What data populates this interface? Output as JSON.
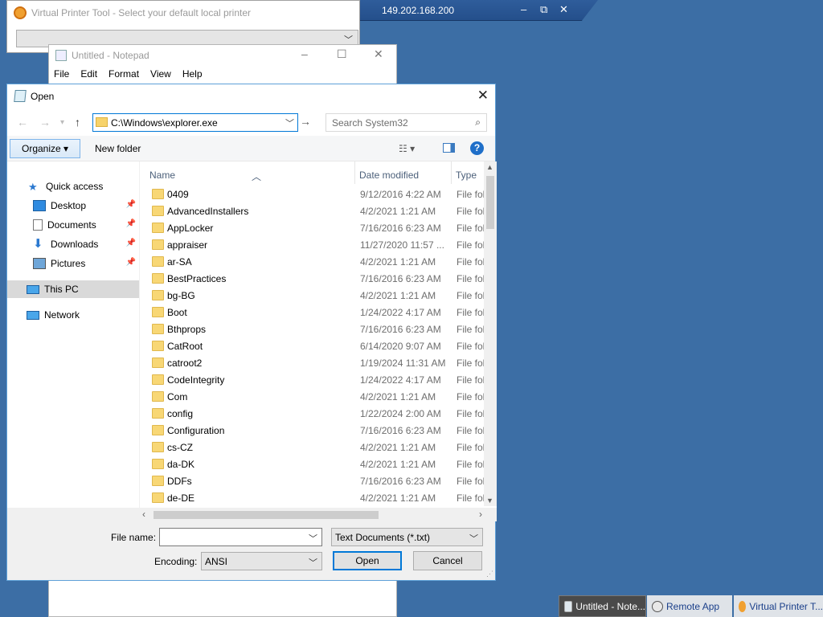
{
  "remote_bar": {
    "host": "149.202.168.200",
    "pin_icon": "pin-icon",
    "signal_icon": "signal-bars-icon"
  },
  "virtual_printer": {
    "title": "Virtual Printer Tool - Select your default local printer",
    "combo_value": ""
  },
  "notepad": {
    "title": "Untitled - Notepad",
    "menu": [
      "File",
      "Edit",
      "Format",
      "View",
      "Help"
    ]
  },
  "dialog": {
    "title": "Open",
    "address": "C:\\Windows\\explorer.exe",
    "search_placeholder": "Search System32",
    "organize_label": "Organize",
    "new_folder_label": "New folder",
    "help_label": "?",
    "nav": [
      {
        "label": "Quick access",
        "icon": "star-icon",
        "pinned": false
      },
      {
        "label": "Desktop",
        "icon": "desktop-icon",
        "pinned": true
      },
      {
        "label": "Documents",
        "icon": "documents-icon",
        "pinned": true
      },
      {
        "label": "Downloads",
        "icon": "downloads-icon",
        "pinned": true
      },
      {
        "label": "Pictures",
        "icon": "pictures-icon",
        "pinned": true
      },
      {
        "label": "This PC",
        "icon": "computer-icon",
        "pinned": false
      },
      {
        "label": "Network",
        "icon": "network-icon",
        "pinned": false
      }
    ],
    "columns": {
      "name": "Name",
      "date": "Date modified",
      "type": "Type"
    },
    "files": [
      {
        "name": "0409",
        "date": "9/12/2016 4:22 AM",
        "type": "File folder"
      },
      {
        "name": "AdvancedInstallers",
        "date": "4/2/2021 1:21 AM",
        "type": "File folder"
      },
      {
        "name": "AppLocker",
        "date": "7/16/2016 6:23 AM",
        "type": "File folder"
      },
      {
        "name": "appraiser",
        "date": "11/27/2020 11:57 ...",
        "type": "File folder"
      },
      {
        "name": "ar-SA",
        "date": "4/2/2021 1:21 AM",
        "type": "File folder"
      },
      {
        "name": "BestPractices",
        "date": "7/16/2016 6:23 AM",
        "type": "File folder"
      },
      {
        "name": "bg-BG",
        "date": "4/2/2021 1:21 AM",
        "type": "File folder"
      },
      {
        "name": "Boot",
        "date": "1/24/2022 4:17 AM",
        "type": "File folder"
      },
      {
        "name": "Bthprops",
        "date": "7/16/2016 6:23 AM",
        "type": "File folder"
      },
      {
        "name": "CatRoot",
        "date": "6/14/2020 9:07 AM",
        "type": "File folder"
      },
      {
        "name": "catroot2",
        "date": "1/19/2024 11:31 AM",
        "type": "File folder"
      },
      {
        "name": "CodeIntegrity",
        "date": "1/24/2022 4:17 AM",
        "type": "File folder"
      },
      {
        "name": "Com",
        "date": "4/2/2021 1:21 AM",
        "type": "File folder"
      },
      {
        "name": "config",
        "date": "1/22/2024 2:00 AM",
        "type": "File folder"
      },
      {
        "name": "Configuration",
        "date": "7/16/2016 6:23 AM",
        "type": "File folder"
      },
      {
        "name": "cs-CZ",
        "date": "4/2/2021 1:21 AM",
        "type": "File folder"
      },
      {
        "name": "da-DK",
        "date": "4/2/2021 1:21 AM",
        "type": "File folder"
      },
      {
        "name": "DDFs",
        "date": "7/16/2016 6:23 AM",
        "type": "File folder"
      },
      {
        "name": "de-DE",
        "date": "4/2/2021 1:21 AM",
        "type": "File folder"
      }
    ],
    "file_name_label": "File name:",
    "file_name_value": "",
    "file_type_value": "Text Documents (*.txt)",
    "encoding_label": "Encoding:",
    "encoding_value": "ANSI",
    "open_label": "Open",
    "cancel_label": "Cancel"
  },
  "taskbar": [
    {
      "label": "Untitled - Note...",
      "icon": "notepad-icon"
    },
    {
      "label": "Remote App",
      "icon": "remote-app-icon"
    },
    {
      "label": "Virtual Printer T...",
      "icon": "printer-icon"
    }
  ],
  "colors": {
    "desktop": "#3c6ea5",
    "accent": "#0078d7",
    "folder": "#f8d775"
  }
}
